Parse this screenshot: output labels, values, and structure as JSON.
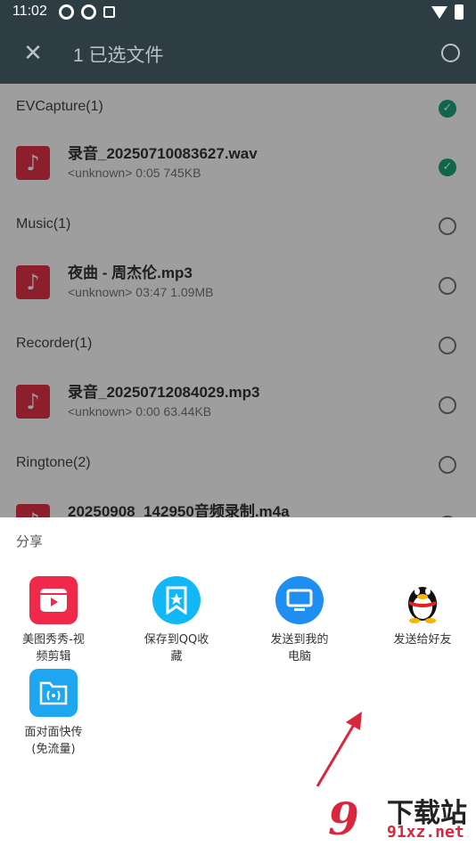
{
  "status_bar": {
    "time": "11:02"
  },
  "top_bar": {
    "title": "1 已选文件",
    "close_glyph": "✕"
  },
  "groups": [
    {
      "title": "EVCapture(1)",
      "checked": true
    },
    {
      "title": "Music(1)",
      "checked": false
    },
    {
      "title": "Recorder(1)",
      "checked": false
    },
    {
      "title": "Ringtone(2)",
      "checked": false
    }
  ],
  "files": [
    {
      "name": "录音_20250710083627.wav",
      "meta": "<unknown> 0:05 745KB",
      "checked": true
    },
    {
      "name": "夜曲 - 周杰伦.mp3",
      "meta": "<unknown> 03:47 1.09MB",
      "checked": false
    },
    {
      "name": "录音_20250712084029.mp3",
      "meta": "<unknown> 0:00 63.44KB",
      "checked": false
    },
    {
      "name": "20250908_142950音频录制.m4a",
      "meta": "",
      "checked": false
    }
  ],
  "share": {
    "title": "分享",
    "items": [
      {
        "label": "美图秀秀-视\n频剪辑",
        "icon": "video-play-icon",
        "color": "#f0284a"
      },
      {
        "label": "保存到QQ收\n藏",
        "icon": "bookmark-star-icon",
        "color": "#12b7f5"
      },
      {
        "label": "发送到我的\n电脑",
        "icon": "monitor-icon",
        "color": "#1e8ff0"
      },
      {
        "label": "发送给好友",
        "icon": "qq-penguin-icon",
        "color": "#ffffff"
      },
      {
        "label": "面对面快传\n(免流量)",
        "icon": "folder-wireless-icon",
        "color": "#1ea6f0"
      }
    ]
  },
  "watermark": {
    "logo": "9",
    "text": "下载站",
    "url": "91xz.net"
  },
  "colors": {
    "accent": "#1aa478",
    "topbar": "#2e3c44",
    "file_icon": "#e4324a",
    "arrow": "#d8263c"
  }
}
